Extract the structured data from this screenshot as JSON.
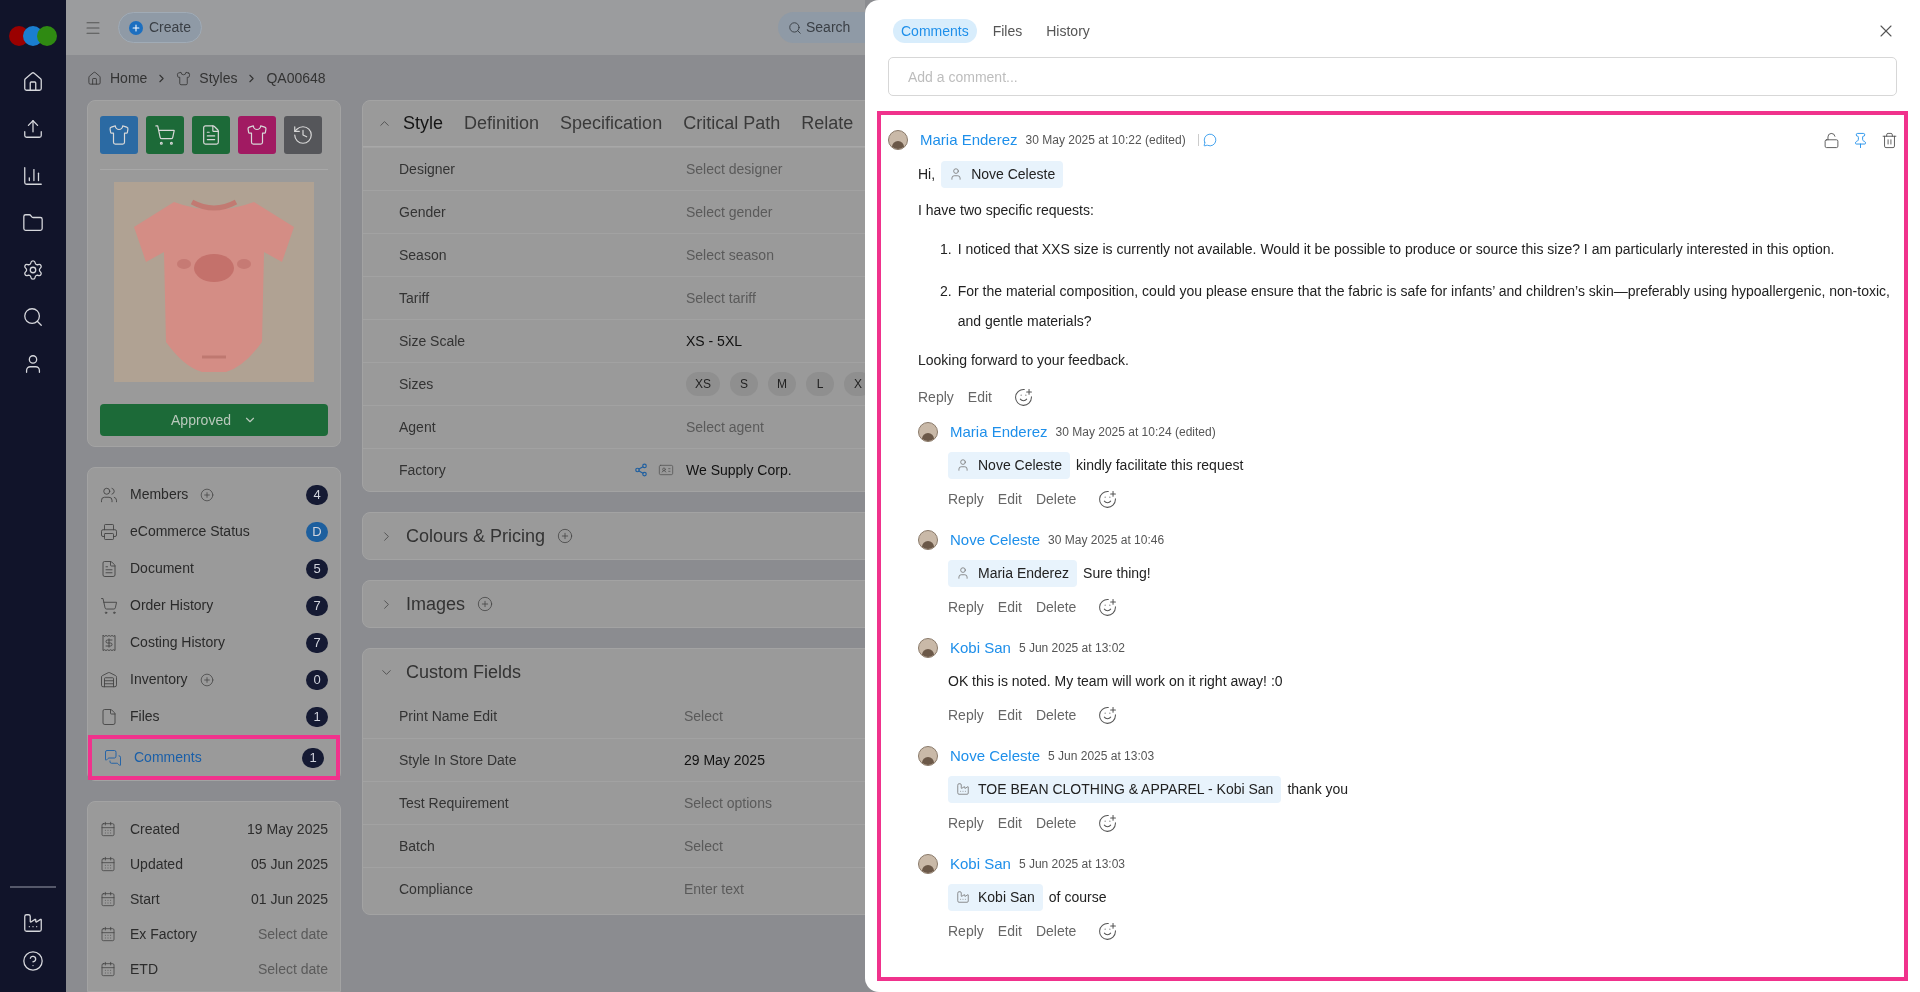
{
  "topbar": {
    "create_label": "Create",
    "search_placeholder": "Search"
  },
  "breadcrumb": [
    "Home",
    "Styles",
    "QA00648"
  ],
  "status_button": {
    "label": "Approved"
  },
  "sidebar_items": [
    {
      "label": "Members",
      "add": true,
      "badge": "4",
      "color": "#151a33",
      "selected": false
    },
    {
      "label": "eCommerce Status",
      "add": false,
      "badge": "D",
      "color": "#1d5f9e",
      "selected": false
    },
    {
      "label": "Document",
      "add": false,
      "badge": "5",
      "color": "#151a33",
      "selected": false
    },
    {
      "label": "Order History",
      "add": false,
      "badge": "7",
      "color": "#151a33",
      "selected": false
    },
    {
      "label": "Costing History",
      "add": false,
      "badge": "7",
      "color": "#151a33",
      "selected": false
    },
    {
      "label": "Inventory",
      "add": true,
      "badge": "0",
      "color": "#151a33",
      "selected": false
    },
    {
      "label": "Files",
      "add": false,
      "badge": "1",
      "color": "#151a33",
      "selected": false
    },
    {
      "label": "Comments",
      "add": false,
      "badge": "1",
      "color": "#151a33",
      "selected": true
    }
  ],
  "dates": [
    {
      "label": "Created",
      "value": "19 May 2025"
    },
    {
      "label": "Updated",
      "value": "05 Jun 2025"
    },
    {
      "label": "Start",
      "value": "01 Jun 2025"
    },
    {
      "label": "Ex Factory",
      "placeholder": "Select date"
    },
    {
      "label": "ETD",
      "placeholder": "Select date"
    }
  ],
  "style_tabs": [
    {
      "label": "Style",
      "selected": true
    },
    {
      "label": "Definition",
      "selected": false
    },
    {
      "label": "Specification",
      "selected": false
    },
    {
      "label": "Critical Path",
      "selected": false
    },
    {
      "label": "Relate",
      "selected": false
    }
  ],
  "style_fields": [
    {
      "kind": "text",
      "label": "Designer",
      "placeholder": "Select designer"
    },
    {
      "kind": "text",
      "label": "Gender",
      "placeholder": "Select gender"
    },
    {
      "kind": "text",
      "label": "Season",
      "placeholder": "Select season"
    },
    {
      "kind": "text",
      "label": "Tariff",
      "placeholder": "Select tariff"
    },
    {
      "kind": "text",
      "label": "Size Scale",
      "value": "XS - 5XL"
    },
    {
      "kind": "chips",
      "label": "Sizes",
      "chips": [
        "XS",
        "S",
        "M",
        "L",
        "X"
      ]
    },
    {
      "kind": "text",
      "label": "Agent",
      "placeholder": "Select agent"
    },
    {
      "kind": "linked",
      "label": "Factory",
      "value": "We Supply Corp."
    }
  ],
  "sections": [
    {
      "title": "Colours & Pricing",
      "expanded": false,
      "add": true
    },
    {
      "title": "Images",
      "expanded": false,
      "add": true
    },
    {
      "title": "Custom Fields",
      "expanded": true,
      "add": false,
      "fields": [
        {
          "label": "Print Name Edit",
          "placeholder": "Select"
        },
        {
          "label": "Style In Store Date",
          "value": "29 May 2025"
        },
        {
          "label": "Test Requirement",
          "placeholder": "Select options"
        },
        {
          "label": "Batch",
          "placeholder": "Select"
        },
        {
          "label": "Compliance",
          "placeholder": "Enter text"
        }
      ]
    }
  ],
  "drawer": {
    "tabs": [
      {
        "label": "Comments",
        "selected": true
      },
      {
        "label": "Files",
        "selected": false
      },
      {
        "label": "History",
        "selected": false
      }
    ],
    "comment_placeholder": "Add a comment...",
    "comment": {
      "author": "Maria Enderez",
      "time": "30 May 2025 at 10:22 (edited)",
      "body": [
        {
          "kind": "mention_line",
          "prefix": "Hi,",
          "mention": {
            "kind": "person",
            "label": "Nove Celeste"
          }
        },
        {
          "kind": "paragraph",
          "text": "I have two specific requests:"
        },
        {
          "kind": "list",
          "items": [
            {
              "number": "1.",
              "text": "I noticed that XXS size is currently not available. Would it be possible to produce or source this size? I am particularly interested in this option."
            },
            {
              "number": "2.",
              "text": "For the material composition, could you please ensure that the fabric is safe for infants’ and children’s skin—preferably using hypoallergenic, non-toxic, and gentle materials?"
            }
          ]
        },
        {
          "kind": "paragraph",
          "text": "Looking forward to your feedback."
        }
      ],
      "actions": [
        "Reply",
        "Edit"
      ],
      "replies": [
        {
          "author": "Maria Enderez",
          "time": "30 May 2025 at 10:24 (edited)",
          "mention": {
            "kind": "person",
            "label": "Nove Celeste"
          },
          "text": "kindly facilitate this request",
          "actions": [
            "Reply",
            "Edit",
            "Delete"
          ]
        },
        {
          "author": "Nove Celeste",
          "time": "30 May 2025 at 10:46",
          "mention": {
            "kind": "person",
            "label": "Maria Enderez"
          },
          "text": "Sure thing!",
          "actions": [
            "Reply",
            "Edit",
            "Delete"
          ]
        },
        {
          "author": "Kobi San",
          "time": "5 Jun 2025 at 13:02",
          "text": "OK this is noted. My team will work on it right away! :0",
          "actions": [
            "Reply",
            "Edit",
            "Delete"
          ]
        },
        {
          "author": "Nove Celeste",
          "time": "5 Jun 2025 at 13:03",
          "mention": {
            "kind": "company",
            "label": "TOE BEAN CLOTHING & APPAREL - Kobi San"
          },
          "text": "thank you",
          "actions": [
            "Reply",
            "Edit",
            "Delete"
          ]
        },
        {
          "author": "Kobi San",
          "time": "5 Jun 2025 at 13:03",
          "mention": {
            "kind": "company",
            "label": "Kobi San"
          },
          "text": "of course",
          "actions": [
            "Reply",
            "Edit",
            "Delete"
          ]
        }
      ]
    }
  }
}
